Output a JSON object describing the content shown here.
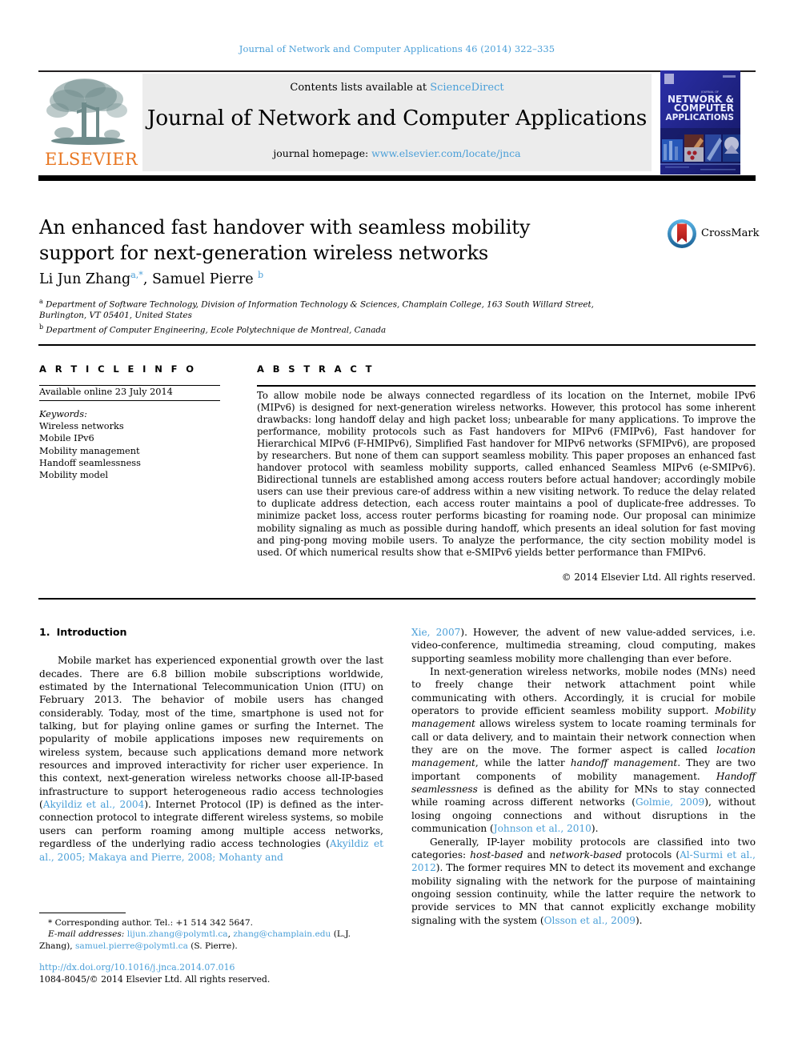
{
  "running_head": "Journal of Network and Computer Applications 46 (2014) 322–335",
  "masthead": {
    "contents_prefix": "Contents lists available at ",
    "sciencedirect": "ScienceDirect",
    "journal_title": "Journal of Network and Computer Applications",
    "homepage_prefix": "journal homepage: ",
    "homepage_url": "www.elsevier.com/locate/jnca",
    "publisher": "ELSEVIER",
    "cover_lines": [
      "NETWORK &",
      "COMPUTER",
      "APPLICATIONS"
    ],
    "cover_kicker": "JOURNAL OF"
  },
  "article": {
    "title": "An enhanced fast handover with seamless mobility support for next-generation wireless networks",
    "authors": "Li Jun Zhang",
    "author1_sup": "a,*",
    "authors2": ", Samuel Pierre ",
    "author2_sup": "b",
    "affiliation_a_mark": "a",
    "affiliation_a": "Department of Software Technology, Division of Information Technology & Sciences, Champlain College, 163 South Willard Street, Burlington, VT 05401, United States",
    "affiliation_b_mark": "b",
    "affiliation_b": "Department of Computer Engineering, Ecole Polytechnique de Montreal, Canada",
    "crossmark_label": "CrossMark"
  },
  "article_info": {
    "heading": "A R T I C L E   I N F O",
    "available_online": "Available online 23 July 2014",
    "keywords_label": "Keywords:",
    "keywords": [
      "Wireless networks",
      "Mobile IPv6",
      "Mobility management",
      "Handoff seamlessness",
      "Mobility model"
    ]
  },
  "abstract": {
    "heading": "A B S T R A C T",
    "text": "To allow mobile node be always connected regardless of its location on the Internet, mobile IPv6 (MIPv6) is designed for next-generation wireless networks. However, this protocol has some inherent drawbacks: long handoff delay and high packet loss; unbearable for many applications. To improve the performance, mobility protocols such as Fast handovers for MIPv6 (FMIPv6), Fast handover for Hierarchical MIPv6 (F-HMIPv6), Simplified Fast handover for MIPv6 networks (SFMIPv6), are proposed by researchers. But none of them can support seamless mobility. This paper proposes an enhanced fast handover protocol with seamless mobility supports, called enhanced Seamless MIPv6 (e-SMIPv6). Bidirectional tunnels are established among access routers before actual handover; accordingly mobile users can use their previous care-of address within a new visiting network. To reduce the delay related to duplicate address detection, each access router maintains a pool of duplicate-free addresses. To minimize packet loss, access router performs bicasting for roaming node. Our proposal can minimize mobility signaling as much as possible during handoff, which presents an ideal solution for fast moving and ping-pong moving mobile users. To analyze the performance, the city section mobility model is used. Of which numerical results show that e-SMIPv6 yields better performance than FMIPv6.",
    "copyright": "© 2014 Elsevier Ltd. All rights reserved."
  },
  "body": {
    "section_number": "1.",
    "section_title": "Introduction",
    "left_p1_a": "Mobile market has experienced exponential growth over the last decades. There are 6.8 billion mobile subscriptions worldwide, estimated by the International Telecommunication Union (ITU) on February 2013. The behavior of mobile users has changed considerably. Today, most of the time, smartphone is used not for talking, but for playing online games or surfing the Internet. The popularity of mobile applications imposes new requirements on wireless system, because such applications demand more network resources and improved interactivity for richer user experience. In this context, next-generation wireless networks choose all-IP-based infrastructure to support heterogeneous radio access technologies (",
    "left_cite1": "Akyildiz et al., 2004",
    "left_p1_b": "). Internet Protocol (IP) is defined as the inter-connection protocol to integrate different wireless systems, so mobile users can perform roaming among multiple access networks, regardless of the underlying radio access technologies (",
    "left_cite2": "Akyildiz et al., 2005; Makaya and Pierre, 2008; Mohanty and",
    "right_cite_cont": "Xie, 2007",
    "right_p1": "). However, the advent of new value-added services, i.e. video-conference, multimedia streaming, cloud computing, makes supporting seamless mobility more challenging than ever before.",
    "right_p2_a": "In next-generation wireless networks, mobile nodes (MNs) need to freely change their network attachment point while communicating with others. Accordingly, it is crucial for mobile operators to provide efficient seamless mobility support. ",
    "right_em1": "Mobility management",
    "right_p2_b": " allows wireless system to locate roaming terminals for call or data delivery, and to maintain their network connection when they are on the move. The former aspect is called ",
    "right_em2": "location management",
    "right_p2_c": ", while the latter ",
    "right_em3": "handoff management",
    "right_p2_d": ". They are two important components of mobility management. ",
    "right_em4": "Handoff seamlessness",
    "right_p2_e": " is defined as the ability for MNs to stay connected while roaming across different networks (",
    "right_cite2": "Golmie, 2009",
    "right_p2_f": "), without losing ongoing connections and without disruptions in the communication (",
    "right_cite3": "Johnson et al., 2010",
    "right_p2_g": ").",
    "right_p3_a": "Generally, IP-layer mobility protocols are classified into two categories: ",
    "right_em5": "host-based",
    "right_p3_b": " and ",
    "right_em6": "network-based",
    "right_p3_c": " protocols (",
    "right_cite4": "Al-Surmi et al., 2012",
    "right_p3_d": "). The former requires MN to detect its movement and exchange mobility signaling with the network for the purpose of maintaining ongoing session continuity, while the latter require the network to provide services to MN that cannot explicitly exchange mobility signaling with the system (",
    "right_cite5": "Olsson et al., 2009",
    "right_p3_e": ")."
  },
  "footnotes": {
    "corresponding": "* Corresponding author. Tel.: +1 514 342 5647.",
    "email_label": "E-mail addresses:",
    "email1": "lijun.zhang@polymtl.ca",
    "email_sep1": ", ",
    "email2": "zhang@champlain.edu",
    "email_owner1": " (L.J. Zhang), ",
    "email3": "samuel.pierre@polymtl.ca",
    "email_owner2": " (S. Pierre).",
    "doi": "http://dx.doi.org/10.1016/j.jnca.2014.07.016",
    "issn_copyright": "1084-8045/© 2014 Elsevier Ltd. All rights reserved."
  },
  "colors": {
    "link": "#4a9fd8",
    "elsevier_orange": "#e87722",
    "cover_blue": "#1b1f8f",
    "band_gray": "#ececec"
  }
}
